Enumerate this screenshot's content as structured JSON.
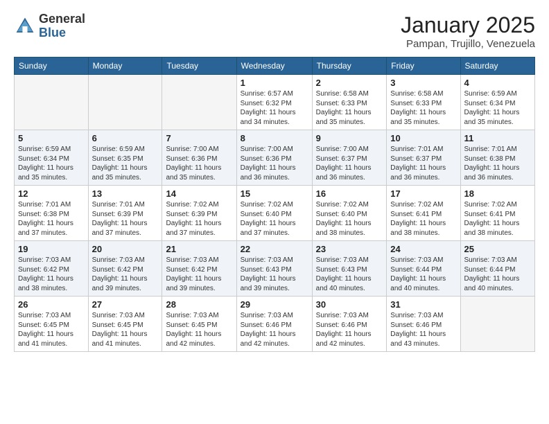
{
  "header": {
    "logo_general": "General",
    "logo_blue": "Blue",
    "month_title": "January 2025",
    "location": "Pampan, Trujillo, Venezuela"
  },
  "days_of_week": [
    "Sunday",
    "Monday",
    "Tuesday",
    "Wednesday",
    "Thursday",
    "Friday",
    "Saturday"
  ],
  "weeks": [
    [
      {
        "day": "",
        "info": ""
      },
      {
        "day": "",
        "info": ""
      },
      {
        "day": "",
        "info": ""
      },
      {
        "day": "1",
        "info": "Sunrise: 6:57 AM\nSunset: 6:32 PM\nDaylight: 11 hours and 34 minutes."
      },
      {
        "day": "2",
        "info": "Sunrise: 6:58 AM\nSunset: 6:33 PM\nDaylight: 11 hours and 35 minutes."
      },
      {
        "day": "3",
        "info": "Sunrise: 6:58 AM\nSunset: 6:33 PM\nDaylight: 11 hours and 35 minutes."
      },
      {
        "day": "4",
        "info": "Sunrise: 6:59 AM\nSunset: 6:34 PM\nDaylight: 11 hours and 35 minutes."
      }
    ],
    [
      {
        "day": "5",
        "info": "Sunrise: 6:59 AM\nSunset: 6:34 PM\nDaylight: 11 hours and 35 minutes."
      },
      {
        "day": "6",
        "info": "Sunrise: 6:59 AM\nSunset: 6:35 PM\nDaylight: 11 hours and 35 minutes."
      },
      {
        "day": "7",
        "info": "Sunrise: 7:00 AM\nSunset: 6:36 PM\nDaylight: 11 hours and 35 minutes."
      },
      {
        "day": "8",
        "info": "Sunrise: 7:00 AM\nSunset: 6:36 PM\nDaylight: 11 hours and 36 minutes."
      },
      {
        "day": "9",
        "info": "Sunrise: 7:00 AM\nSunset: 6:37 PM\nDaylight: 11 hours and 36 minutes."
      },
      {
        "day": "10",
        "info": "Sunrise: 7:01 AM\nSunset: 6:37 PM\nDaylight: 11 hours and 36 minutes."
      },
      {
        "day": "11",
        "info": "Sunrise: 7:01 AM\nSunset: 6:38 PM\nDaylight: 11 hours and 36 minutes."
      }
    ],
    [
      {
        "day": "12",
        "info": "Sunrise: 7:01 AM\nSunset: 6:38 PM\nDaylight: 11 hours and 37 minutes."
      },
      {
        "day": "13",
        "info": "Sunrise: 7:01 AM\nSunset: 6:39 PM\nDaylight: 11 hours and 37 minutes."
      },
      {
        "day": "14",
        "info": "Sunrise: 7:02 AM\nSunset: 6:39 PM\nDaylight: 11 hours and 37 minutes."
      },
      {
        "day": "15",
        "info": "Sunrise: 7:02 AM\nSunset: 6:40 PM\nDaylight: 11 hours and 37 minutes."
      },
      {
        "day": "16",
        "info": "Sunrise: 7:02 AM\nSunset: 6:40 PM\nDaylight: 11 hours and 38 minutes."
      },
      {
        "day": "17",
        "info": "Sunrise: 7:02 AM\nSunset: 6:41 PM\nDaylight: 11 hours and 38 minutes."
      },
      {
        "day": "18",
        "info": "Sunrise: 7:02 AM\nSunset: 6:41 PM\nDaylight: 11 hours and 38 minutes."
      }
    ],
    [
      {
        "day": "19",
        "info": "Sunrise: 7:03 AM\nSunset: 6:42 PM\nDaylight: 11 hours and 38 minutes."
      },
      {
        "day": "20",
        "info": "Sunrise: 7:03 AM\nSunset: 6:42 PM\nDaylight: 11 hours and 39 minutes."
      },
      {
        "day": "21",
        "info": "Sunrise: 7:03 AM\nSunset: 6:42 PM\nDaylight: 11 hours and 39 minutes."
      },
      {
        "day": "22",
        "info": "Sunrise: 7:03 AM\nSunset: 6:43 PM\nDaylight: 11 hours and 39 minutes."
      },
      {
        "day": "23",
        "info": "Sunrise: 7:03 AM\nSunset: 6:43 PM\nDaylight: 11 hours and 40 minutes."
      },
      {
        "day": "24",
        "info": "Sunrise: 7:03 AM\nSunset: 6:44 PM\nDaylight: 11 hours and 40 minutes."
      },
      {
        "day": "25",
        "info": "Sunrise: 7:03 AM\nSunset: 6:44 PM\nDaylight: 11 hours and 40 minutes."
      }
    ],
    [
      {
        "day": "26",
        "info": "Sunrise: 7:03 AM\nSunset: 6:45 PM\nDaylight: 11 hours and 41 minutes."
      },
      {
        "day": "27",
        "info": "Sunrise: 7:03 AM\nSunset: 6:45 PM\nDaylight: 11 hours and 41 minutes."
      },
      {
        "day": "28",
        "info": "Sunrise: 7:03 AM\nSunset: 6:45 PM\nDaylight: 11 hours and 42 minutes."
      },
      {
        "day": "29",
        "info": "Sunrise: 7:03 AM\nSunset: 6:46 PM\nDaylight: 11 hours and 42 minutes."
      },
      {
        "day": "30",
        "info": "Sunrise: 7:03 AM\nSunset: 6:46 PM\nDaylight: 11 hours and 42 minutes."
      },
      {
        "day": "31",
        "info": "Sunrise: 7:03 AM\nSunset: 6:46 PM\nDaylight: 11 hours and 43 minutes."
      },
      {
        "day": "",
        "info": ""
      }
    ]
  ]
}
